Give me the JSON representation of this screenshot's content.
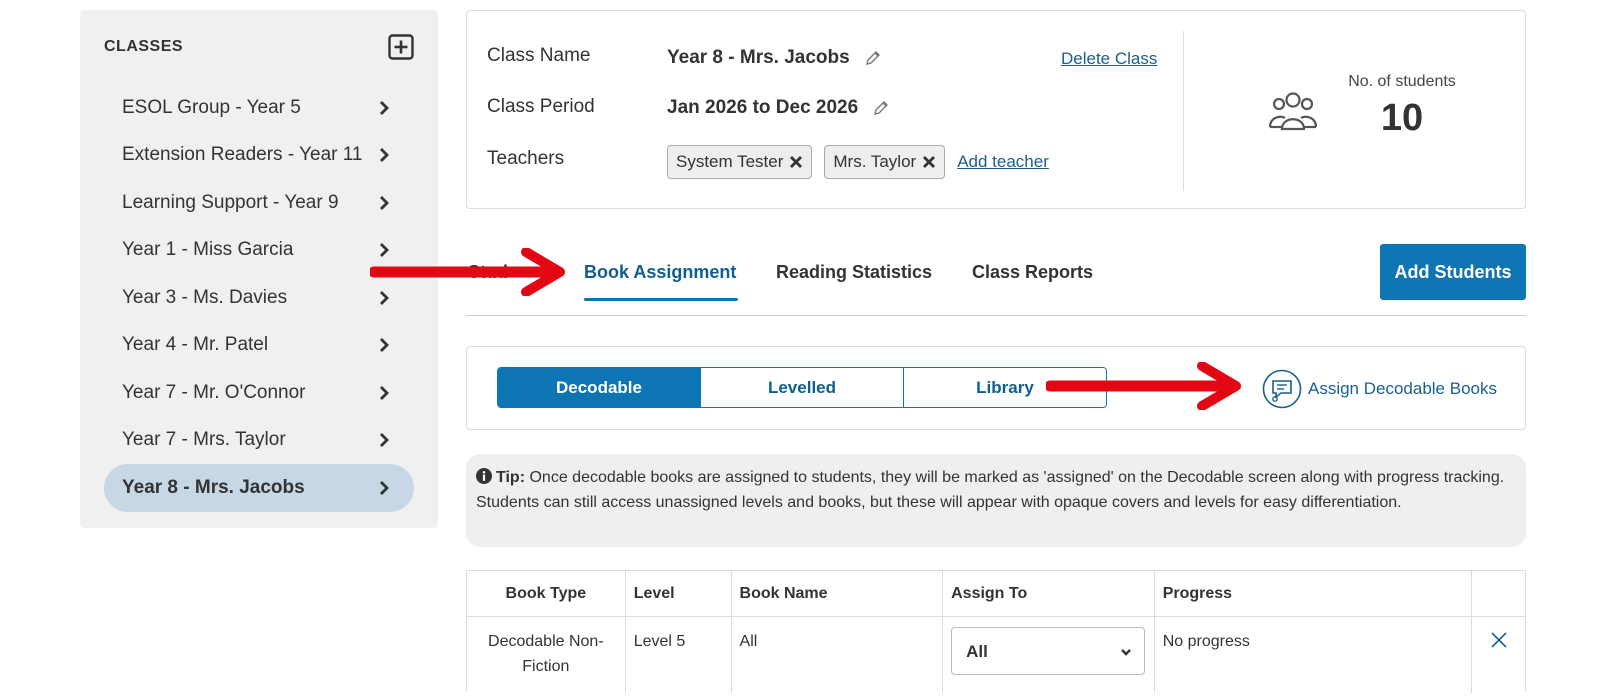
{
  "sidebar": {
    "title": "CLASSES",
    "add_icon": "plus-square-icon",
    "items": [
      {
        "label": "ESOL Group - Year 5",
        "active": false
      },
      {
        "label": "Extension Readers - Year 11",
        "active": false
      },
      {
        "label": "Learning Support - Year 9",
        "active": false
      },
      {
        "label": "Year 1 - Miss Garcia",
        "active": false
      },
      {
        "label": "Year 3 - Ms. Davies",
        "active": false
      },
      {
        "label": "Year 4 - Mr. Patel",
        "active": false
      },
      {
        "label": "Year 7 - Mr. O'Connor",
        "active": false
      },
      {
        "label": "Year 7 - Mrs. Taylor",
        "active": false
      },
      {
        "label": "Year 8 - Mrs. Jacobs",
        "active": true
      }
    ]
  },
  "class_info": {
    "name_label": "Class Name",
    "name_value": "Year 8 - Mrs. Jacobs",
    "period_label": "Class Period",
    "period_value": "Jan 2026 to Dec 2026",
    "teachers_label": "Teachers",
    "teachers": [
      "System Tester",
      "Mrs. Taylor"
    ],
    "add_teacher": "Add teacher",
    "delete_class": "Delete Class",
    "students_label": "No. of students",
    "students_count": "10"
  },
  "tabs": {
    "partial_first": "Stud",
    "items": [
      "Book Assignment",
      "Reading Statistics",
      "Class Reports"
    ],
    "active": "Book Assignment",
    "add_students": "Add Students"
  },
  "book_types": {
    "segments": [
      "Decodable",
      "Levelled",
      "Library"
    ],
    "active": "Decodable",
    "assign_label": "Assign Decodable Books"
  },
  "tip": {
    "label": "Tip:",
    "text": " Once decodable books are assigned to students, they will be marked as 'assigned' on the Decodable screen along with progress tracking. Students can still access unassigned levels and books, but these will appear with opaque covers and levels for easy differentiation."
  },
  "table": {
    "headers": [
      "Book Type",
      "Level",
      "Book Name",
      "Assign To",
      "Progress",
      ""
    ],
    "rows": [
      {
        "book_type": "Decodable Non-Fiction",
        "level": "Level 5",
        "book_name": "All",
        "assign_to": "All",
        "progress": "No progress"
      }
    ]
  },
  "colors": {
    "primary": "#0e75b5",
    "link": "#1a5f8e",
    "annotation_arrow": "#e30613",
    "active_sidebar": "#c7d7e5"
  }
}
